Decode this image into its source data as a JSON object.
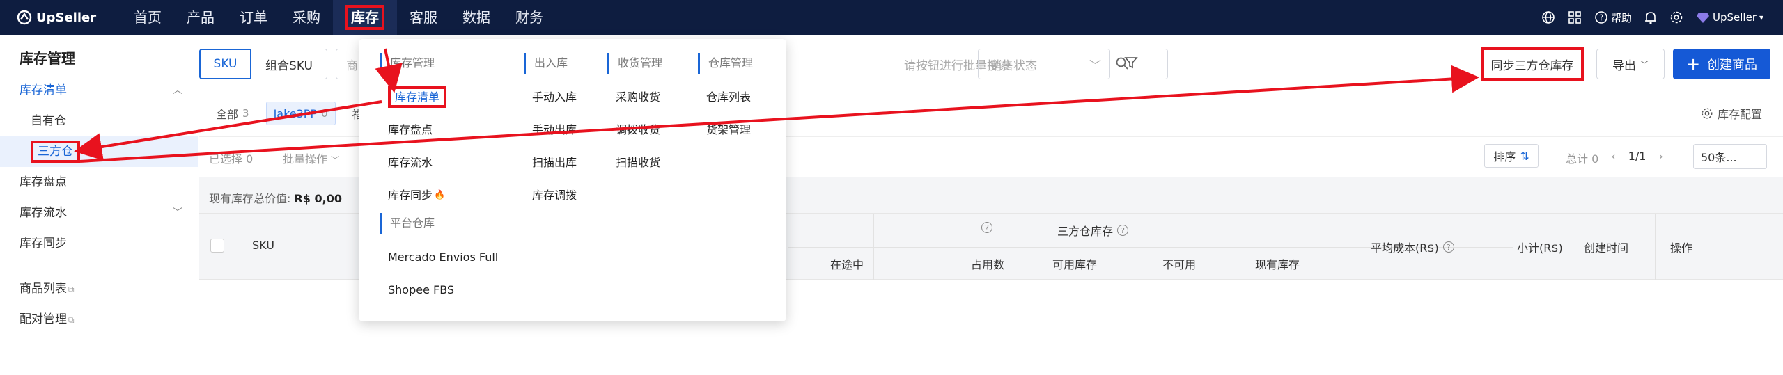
{
  "app": {
    "name": "UpSeller"
  },
  "topnav": {
    "items": [
      "首页",
      "产品",
      "订单",
      "采购",
      "库存",
      "客服",
      "数据",
      "财务"
    ],
    "active": "库存",
    "help": "帮助",
    "account": "UpSeller"
  },
  "sidebar": {
    "title": "库存管理",
    "inventory_list": "库存清单",
    "own_warehouse": "自有仓",
    "third_party_warehouse": "三方仓",
    "stock_check": "库存盘点",
    "stock_flow": "库存流水",
    "stock_sync": "库存同步",
    "product_list": "商品列表",
    "pairing_mgmt": "配对管理"
  },
  "toolbar": {
    "sku_tab": "SKU",
    "combo_sku_tab": "组合SKU",
    "search_prefix": "商",
    "search_placeholder": "请按钮进行批量搜索",
    "sales_status_placeholder": "销售状态",
    "sync_button": "同步三方仓库存",
    "export_button": "导出",
    "create_button": "创建商品"
  },
  "filter_tabs": {
    "all_label": "全部",
    "all_count": "3",
    "jake_label": "Jake3PP",
    "jake_count": "0",
    "more": "福",
    "stock_config": "库存配置"
  },
  "list_bar": {
    "selected_label": "已选择",
    "selected_count": "0",
    "batch_ops": "批量操作",
    "sort": "排序",
    "total_label": "总计",
    "total_count": "0",
    "page": "1/1",
    "page_size": "50条..."
  },
  "summary": {
    "label": "现有库存总价值: ",
    "value": "R$ 0,00"
  },
  "table": {
    "col_sku": "SKU",
    "group_third_party": "三方仓库存",
    "col_in_transit": "在途中",
    "col_occupied": "占用数",
    "col_available": "可用库存",
    "col_unavailable": "不可用",
    "col_on_hand": "现有库存",
    "col_avg_cost": "平均成本(R$)",
    "col_subtotal": "小计(R$)",
    "col_created": "创建时间",
    "col_actions": "操作"
  },
  "dropdown": {
    "col1_head": "库存管理",
    "col1_items": [
      "库存清单",
      "库存盘点",
      "库存流水",
      "库存同步"
    ],
    "col1b_head": "平台仓库",
    "col1b_items": [
      "Mercado Envios Full",
      "Shopee FBS"
    ],
    "col2_head": "出入库",
    "col2_items": [
      "手动入库",
      "手动出库",
      "扫描出库",
      "库存调拨"
    ],
    "col3_head": "收货管理",
    "col3_items": [
      "采购收货",
      "调拨收货",
      "扫描收货"
    ],
    "col4_head": "仓库管理",
    "col4_items": [
      "仓库列表",
      "货架管理"
    ]
  },
  "colors": {
    "nav_bg": "#0e1d40",
    "accent": "#1a66d6",
    "highlight": "#e8121e",
    "create_button": "#1559d6"
  }
}
